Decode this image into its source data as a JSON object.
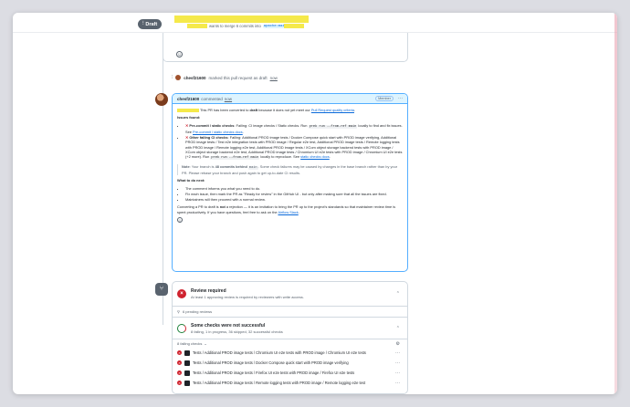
{
  "header": {
    "draft_badge": "Draft",
    "meta_text": "wants to merge 6 commits into",
    "base_branch": "apache:main",
    "from_text": "from"
  },
  "timeline_event": {
    "user": "chesf21600",
    "text": "marked this pull request as draft",
    "time": "now"
  },
  "comment": {
    "author": "chesf21600",
    "verb": "commented",
    "time": "now",
    "role": "Member",
    "intro_a": "This PR has been converted to",
    "intro_draft": "draft",
    "intro_b": "because it does not yet meet our",
    "intro_link": "Pull Request quality criteria",
    "intro_end": ".",
    "issues_heading": "Issues found:",
    "issue1_label": "Pre-commit / static checks",
    "issue1_a": ": Failing: CI image checks / Static checks. Run",
    "issue1_code": "prek run --from-ref main",
    "issue1_b": "locally to find and fix issues. See",
    "issue1_link": "Pre-commit / static checks docs",
    "issue1_end": ".",
    "issue2_label": "Other failing CI checks",
    "issue2_a": ": Failing: Additional PROD image tests / Docker Compose quick start with PROD image verifying, Additional PROD image tests / Test e2e integration tests with PROD image / Regular e2e test, Additional PROD image tests / Remote logging tests with PROD image / Remote logging e2e test, Additional PROD image tests / XCom object storage backend tests with PROD image / XCom object storage backend e2e test, Additional PROD image tests / Chromium UI e2e tests with PROD image / Chromium UI e2e tests (+2 more). Run",
    "issue2_code1": "prek run --from-ref main",
    "issue2_b": "locally to reproduce. See",
    "issue2_link": "static checks docs",
    "issue2_end": ".",
    "note_label": "Note",
    "note_a": ": Your branch is",
    "note_strong": "48 commits behind",
    "note_code": "main",
    "note_b": ". Some check failures may be caused by changes in the base branch rather than by your PR. Please rebase your branch and push again to get up-to-date CI results.",
    "todo_heading": "What to do next:",
    "todo1": "The comment informs you what you need to do.",
    "todo2": "Fix each issue, then mark the PR as \"Ready for review\" in the GitHub UI - but only after making sure that all the issues are fixed.",
    "todo3": "Maintainers will then proceed with a normal review.",
    "outro_a": "Converting a PR to draft is",
    "outro_not": "not",
    "outro_b": "a rejection — it is an invitation to bring the PR up to the project's standards so that maintainer review time is spent productively. If you have questions, feel free to ask on the",
    "outro_link": "Airflow Slack",
    "outro_end": "."
  },
  "merge": {
    "review_title": "Review required",
    "review_sub": "At least 1 approving review is required by reviewers with write access.",
    "pending": "6 pending reviews",
    "checks_title": "Some checks were not successful",
    "checks_sub": "8 failing, 1 in progress, 36 skipped, 32 successful checks",
    "failing_head": "8 failing checks",
    "checks": [
      "Tests / Additional PROD image tests / Chromium UI e2e tests with PROD image / Chromium UI e2e tests",
      "Tests / Additional PROD image tests / Docker Compose quick start with PROD image verifying",
      "Tests / Additional PROD image tests / Firefox UI e2e tests with PROD image / Firefox UI e2e tests",
      "Tests / Additional PROD image tests / Remote logging tests with PROD image / Remote logging e2e test"
    ]
  },
  "colors": {
    "accent": "#0969da",
    "danger": "#cf222e",
    "success": "#1a7f37",
    "highlight": "#f5e94a"
  }
}
